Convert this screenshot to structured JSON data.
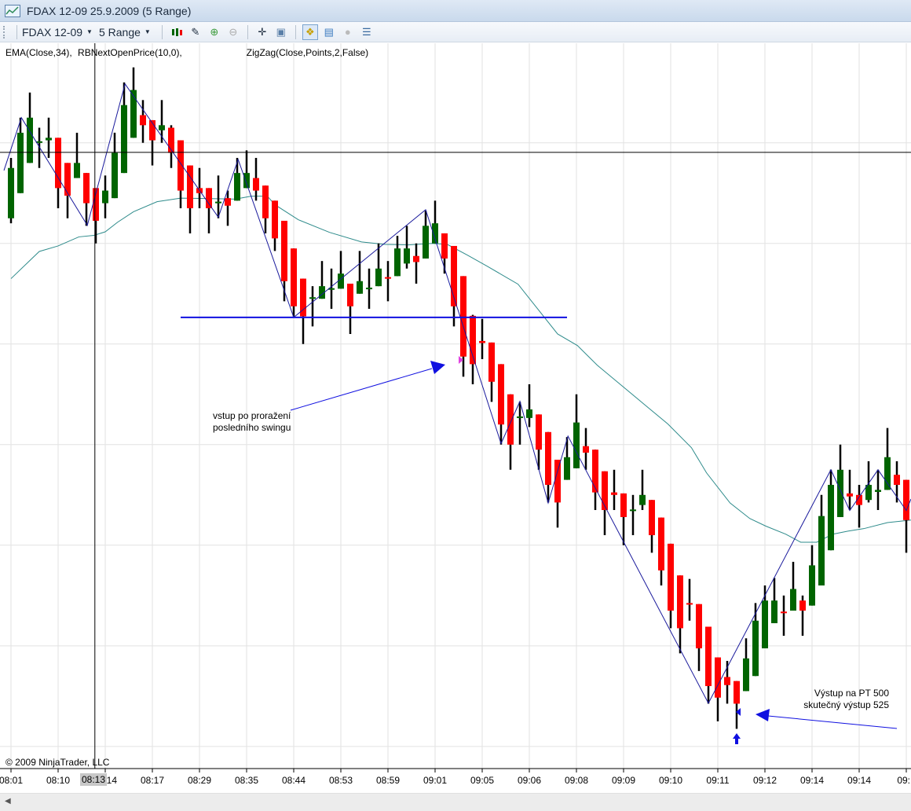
{
  "window": {
    "title": "FDAX 12-09  25.9.2009 (5 Range)"
  },
  "toolbar": {
    "instrument": "FDAX 12-09",
    "period": "5 Range",
    "icons": [
      "candlestick-style-icon",
      "pencil-draw-icon",
      "zoom-in-icon",
      "zoom-out-icon",
      "crosshair-icon",
      "data-box-icon",
      "indicators-icon",
      "strategy-icon",
      "chart-trader-icon",
      "properties-icon"
    ]
  },
  "legend": {
    "ema": "EMA(Close,34),",
    "rb": "RBNextOpenPrice(10,0),",
    "zigzag": "ZigZag(Close,Points,2,False)"
  },
  "copyright": "© 2009 NinjaTrader, LLC",
  "cursor_time": "08:13",
  "annotations": {
    "entry_line1": "vstup po proražení",
    "entry_line2": "posledního swingu",
    "exit_line1": "Výstup na PT 500",
    "exit_line2": "skutečný výstup 525"
  },
  "colors": {
    "up": "#006400",
    "down": "#ff0000",
    "wick": "#000000",
    "ema": "#2e8b8b",
    "zigzag": "#1a1a9c",
    "drawing": "#1010e0",
    "grid": "#e2e2e2"
  },
  "chart_data": {
    "type": "candlestick",
    "title": "",
    "xlabel": "",
    "ylabel": "",
    "y_axis_labels_visible": false,
    "ylim": [
      -4.4,
      139.8
    ],
    "grid": true,
    "x_ticks": [
      {
        "bar": 0,
        "label": "08:01"
      },
      {
        "bar": 5,
        "label": "08:10"
      },
      {
        "bar": 10,
        "label": "08:14"
      },
      {
        "bar": 15,
        "label": "08:17"
      },
      {
        "bar": 20,
        "label": "08:29"
      },
      {
        "bar": 25,
        "label": "08:35"
      },
      {
        "bar": 30,
        "label": "08:44"
      },
      {
        "bar": 35,
        "label": "08:53"
      },
      {
        "bar": 40,
        "label": "08:59"
      },
      {
        "bar": 45,
        "label": "09:01"
      },
      {
        "bar": 50,
        "label": "09:05"
      },
      {
        "bar": 55,
        "label": "09:06"
      },
      {
        "bar": 60,
        "label": "09:08"
      },
      {
        "bar": 65,
        "label": "09:09"
      },
      {
        "bar": 70,
        "label": "09:10"
      },
      {
        "bar": 75,
        "label": "09:11"
      },
      {
        "bar": 80,
        "label": "09:12"
      },
      {
        "bar": 85,
        "label": "09:14"
      },
      {
        "bar": 90,
        "label": "09:14"
      },
      {
        "bar": 95,
        "label": "09:1"
      }
    ],
    "candles_ohlc": [
      [
        105,
        117,
        104,
        115
      ],
      [
        110,
        125,
        110,
        122
      ],
      [
        116,
        130,
        116,
        125
      ],
      [
        120,
        123,
        115,
        120.3
      ],
      [
        120.5,
        125,
        117,
        121
      ],
      [
        121,
        121,
        107,
        111
      ],
      [
        116,
        116,
        105,
        109.5
      ],
      [
        113,
        122,
        113,
        116
      ],
      [
        114,
        114,
        103.5,
        108
      ],
      [
        111,
        111,
        100,
        104.5
      ],
      [
        108,
        113.5,
        105,
        110.5
      ],
      [
        109,
        122,
        109,
        118
      ],
      [
        114,
        132,
        114,
        127.5
      ],
      [
        121,
        135,
        121,
        130.5
      ],
      [
        125.5,
        128.5,
        120,
        123.5
      ],
      [
        124.5,
        124.5,
        115.5,
        120.5
      ],
      [
        122.5,
        128.5,
        120,
        123.5
      ],
      [
        123,
        123.5,
        115,
        118
      ],
      [
        120.5,
        120.5,
        107,
        110.5
      ],
      [
        115.5,
        115.5,
        102,
        107
      ],
      [
        111,
        115,
        107,
        110
      ],
      [
        111,
        111,
        102,
        107
      ],
      [
        108,
        113.5,
        105,
        108.3
      ],
      [
        109,
        110.5,
        103.5,
        107.5
      ],
      [
        108.5,
        117,
        108.5,
        114
      ],
      [
        111,
        118.5,
        111,
        114
      ],
      [
        113,
        117,
        108.5,
        110.5
      ],
      [
        111.5,
        111.5,
        102,
        105
      ],
      [
        108.5,
        108.5,
        98.5,
        101
      ],
      [
        104.5,
        104.5,
        88.5,
        92.5
      ],
      [
        99,
        99,
        85.5,
        87.5
      ],
      [
        93,
        93,
        80,
        85.5
      ],
      [
        89,
        91.5,
        83.5,
        89.3
      ],
      [
        89,
        96.5,
        89,
        91.5
      ],
      [
        90.8,
        95,
        87,
        91.1
      ],
      [
        91,
        98.5,
        91,
        94
      ],
      [
        92,
        92,
        82,
        87.5
      ],
      [
        90,
        98.5,
        90,
        92.5
      ],
      [
        91,
        95,
        87,
        91.2
      ],
      [
        91.5,
        100,
        91.5,
        95
      ],
      [
        93.3,
        96.5,
        88.5,
        93
      ],
      [
        93.5,
        101.5,
        93.5,
        99
      ],
      [
        96,
        103.5,
        95,
        99
      ],
      [
        97.5,
        100,
        92,
        96.3
      ],
      [
        97,
        106.5,
        97,
        103.5
      ],
      [
        100,
        108.5,
        100,
        104
      ],
      [
        102,
        102,
        94,
        97
      ],
      [
        99.5,
        99.5,
        83.5,
        87.5
      ],
      [
        93.5,
        93.5,
        73.5,
        77.5
      ],
      [
        85.6,
        85.8,
        72,
        76
      ],
      [
        80.6,
        85,
        77,
        80.2
      ],
      [
        80.3,
        80.3,
        68.5,
        72.5
      ],
      [
        76,
        76,
        60,
        64
      ],
      [
        70,
        70,
        55,
        60
      ],
      [
        65.3,
        68.5,
        60,
        65.6
      ],
      [
        65.3,
        72,
        63.5,
        67
      ],
      [
        66,
        66,
        55,
        59
      ],
      [
        62.5,
        62.5,
        48.5,
        52
      ],
      [
        57,
        57,
        43.5,
        48.5
      ],
      [
        53,
        61.5,
        53,
        57.5
      ],
      [
        55.3,
        70,
        55.3,
        64.4
      ],
      [
        59.7,
        63.3,
        55,
        58.4
      ],
      [
        59,
        59,
        47,
        50.5
      ],
      [
        54.7,
        54.7,
        42,
        47
      ],
      [
        50.5,
        55,
        47,
        50
      ],
      [
        50.3,
        50.3,
        40,
        45.6
      ],
      [
        47,
        50,
        42,
        47.1
      ],
      [
        48,
        55,
        47,
        50
      ],
      [
        49,
        49,
        38.5,
        42
      ],
      [
        45.5,
        45.5,
        32,
        35
      ],
      [
        40.3,
        40.3,
        23.5,
        27
      ],
      [
        34,
        34,
        18.5,
        23.5
      ],
      [
        28.5,
        33.3,
        25,
        28.3
      ],
      [
        28.3,
        28.3,
        15,
        19.5
      ],
      [
        23.8,
        23.8,
        8.5,
        12
      ],
      [
        17.7,
        17.7,
        5,
        9.7
      ],
      [
        13.8,
        17,
        8.5,
        12.2
      ],
      [
        13,
        13,
        3.5,
        8.5
      ],
      [
        11,
        21.5,
        11,
        17.5
      ],
      [
        14,
        28.5,
        14,
        25
      ],
      [
        19.5,
        32,
        19.5,
        29
      ],
      [
        24.5,
        33.5,
        24.5,
        29
      ],
      [
        26.8,
        30,
        22,
        26.6
      ],
      [
        27,
        36.7,
        27,
        31.3
      ],
      [
        29,
        30,
        22,
        27
      ],
      [
        28,
        40,
        28,
        36
      ],
      [
        32,
        50,
        32,
        45.8
      ],
      [
        39,
        55,
        39,
        52
      ],
      [
        45.6,
        60,
        45.6,
        55
      ],
      [
        50.3,
        55,
        47,
        49.7
      ],
      [
        50,
        52,
        43.5,
        48
      ],
      [
        49,
        56.7,
        48.5,
        52
      ],
      [
        50.6,
        55,
        47,
        51
      ],
      [
        51,
        63.3,
        51,
        57.5
      ],
      [
        54,
        56.7,
        48.5,
        52
      ],
      [
        53,
        53,
        38.5,
        45
      ]
    ],
    "ema_34": [
      [
        0,
        93
      ],
      [
        3,
        98.4
      ],
      [
        5,
        99.5
      ],
      [
        7.2,
        101.3
      ],
      [
        8.8,
        101.6
      ],
      [
        10,
        102.3
      ],
      [
        11.3,
        104.2
      ],
      [
        13,
        106.3
      ],
      [
        15.5,
        108.3
      ],
      [
        18,
        109
      ],
      [
        21.3,
        108.9
      ],
      [
        23.8,
        108.8
      ],
      [
        25.5,
        109.4
      ],
      [
        27.2,
        109.4
      ],
      [
        28,
        107.7
      ],
      [
        30.5,
        104.7
      ],
      [
        33.8,
        102.2
      ],
      [
        37.2,
        100.3
      ],
      [
        39.7,
        99.8
      ],
      [
        42.2,
        99.7
      ],
      [
        44.7,
        100
      ],
      [
        46.3,
        99.8
      ],
      [
        48.4,
        97.7
      ],
      [
        50.5,
        95.5
      ],
      [
        53.8,
        91.9
      ],
      [
        58,
        82
      ],
      [
        60.1,
        79.7
      ],
      [
        62.2,
        75.8
      ],
      [
        64.7,
        71.9
      ],
      [
        67.2,
        68
      ],
      [
        69.7,
        64.1
      ],
      [
        72.2,
        59.4
      ],
      [
        73.8,
        54.4
      ],
      [
        76.3,
        48.4
      ],
      [
        78.4,
        45.3
      ],
      [
        80.1,
        43.8
      ],
      [
        82.2,
        42.2
      ],
      [
        83.8,
        40.6
      ],
      [
        85.5,
        40.6
      ],
      [
        87.2,
        42.2
      ],
      [
        88.8,
        42.8
      ],
      [
        90.5,
        43.3
      ],
      [
        93,
        44.5
      ],
      [
        95.5,
        45
      ]
    ],
    "zigzag": [
      [
        -0.75,
        114.5
      ],
      [
        1.1,
        125
      ],
      [
        8.1,
        103.6
      ],
      [
        12.1,
        131.7
      ],
      [
        22,
        105.2
      ],
      [
        24.1,
        116.7
      ],
      [
        30,
        85.3
      ],
      [
        44,
        106.7
      ],
      [
        52,
        60.2
      ],
      [
        54,
        68.6
      ],
      [
        57,
        48.4
      ],
      [
        59.1,
        61.7
      ],
      [
        74,
        8.6
      ],
      [
        87,
        55
      ],
      [
        89,
        46.9
      ],
      [
        92,
        55
      ],
      [
        95,
        46.9
      ],
      [
        95.5,
        49.2
      ]
    ],
    "horizontal_line": {
      "from_bar": 18,
      "to_bar": 59,
      "value": 85.3
    },
    "crosshair": {
      "bar": 8.9,
      "value": 118.1
    }
  }
}
